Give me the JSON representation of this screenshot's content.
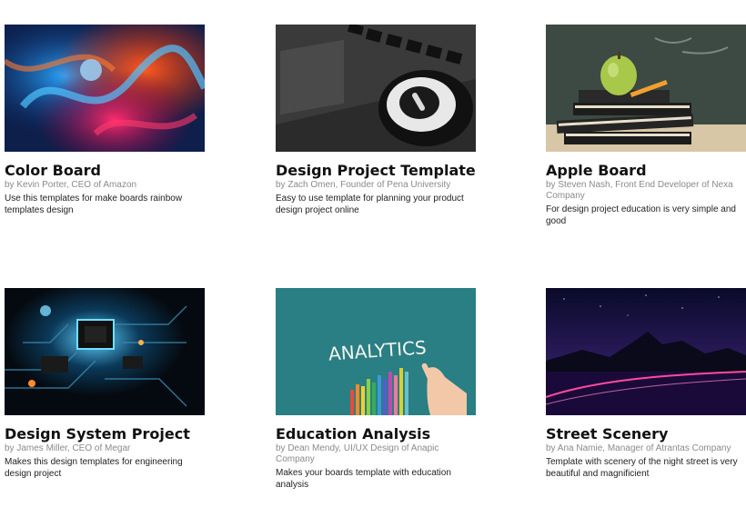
{
  "cards": [
    {
      "title": "Color Board",
      "author": "by Kevin Porter, CEO of Amazon",
      "description": "Use this templates for make boards rainbow templates design",
      "image": "colorful-ink-smoke"
    },
    {
      "title": "Design Project Template",
      "author": "by Zach Omen, Founder of Pena University",
      "description": "Easy to use template for planning your product design project online",
      "image": "keyboard-and-mouse"
    },
    {
      "title": "Apple Board",
      "author": "by Steven Nash, Front End Developer of Nexa Company",
      "description": "For design project education is very simple and good",
      "image": "apple-on-books"
    },
    {
      "title": "Design System Project",
      "author": "by James Miller, CEO of Megar",
      "description": "Makes this design templates for engineering design project",
      "image": "circuit-board"
    },
    {
      "title": "Education Analysis",
      "author": "by Dean Mendy, UI/UX Design of Anapic Company",
      "description": "Makes your boards template with education analysis",
      "image": "analytics-chalkboard",
      "image_text": "ANALYTICS"
    },
    {
      "title": "Street Scenery",
      "author": "by Ana Namie, Manager of Atrantas Company",
      "description": "Template with scenery of the night street is very beautiful and magnificient",
      "image": "night-street-mountains"
    }
  ]
}
